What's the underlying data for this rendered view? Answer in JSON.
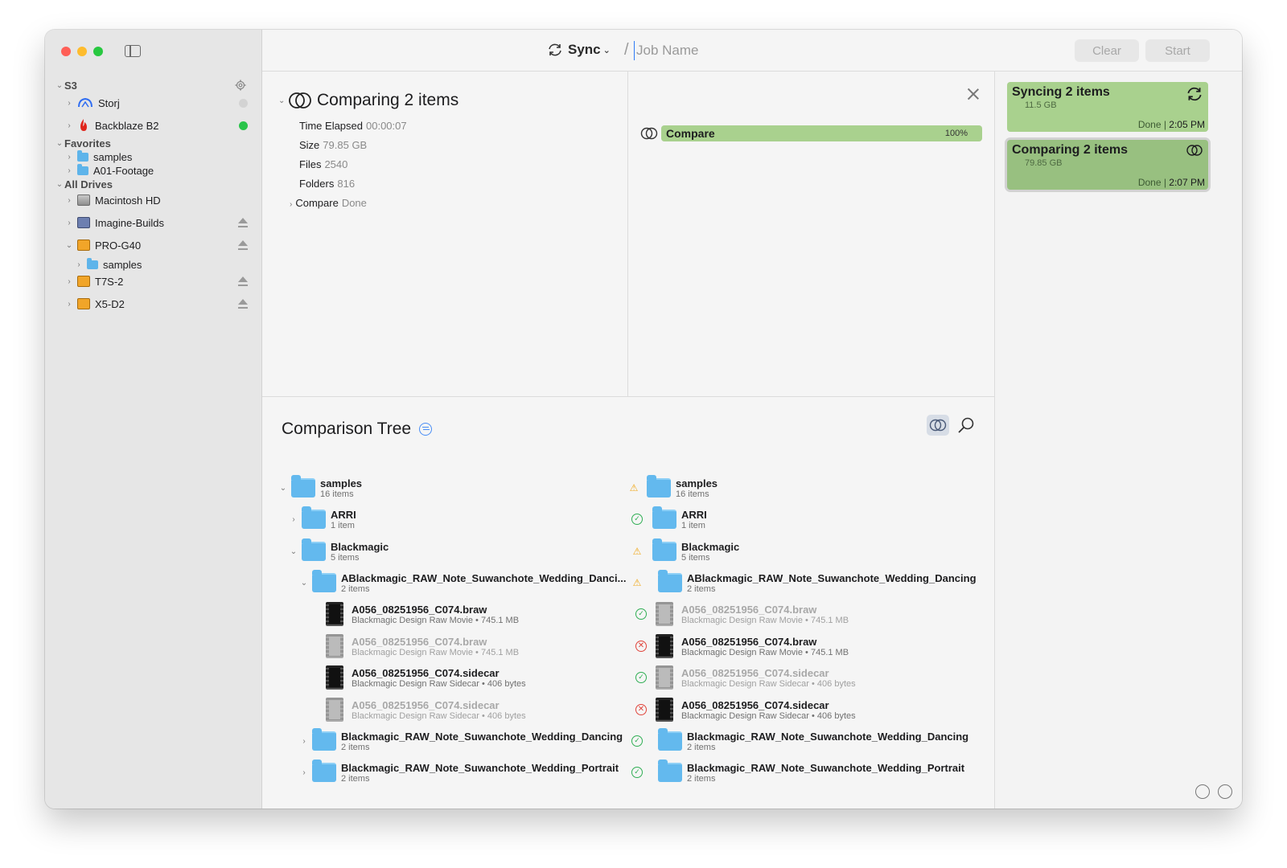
{
  "window": {
    "traffic_lights": {
      "close": "#ff5f57",
      "minimize": "#febc2e",
      "zoom": "#28c840"
    }
  },
  "sidebar": {
    "sections": [
      {
        "label": "S3"
      },
      {
        "label": "Favorites"
      },
      {
        "label": "All Drives"
      }
    ],
    "s3_items": [
      {
        "label": "Storj",
        "icon": "storj-cloud-icon",
        "status": "gray"
      },
      {
        "label": "Backblaze B2",
        "icon": "backblaze-flame-icon",
        "status": "green"
      }
    ],
    "favorites": [
      {
        "label": "samples",
        "icon": "folder-icon"
      },
      {
        "label": "A01-Footage",
        "icon": "folder-icon"
      }
    ],
    "drives": [
      {
        "label": "Macintosh HD",
        "icon": "hard-drive-icon"
      },
      {
        "label": "Imagine-Builds",
        "icon": "disk-image-icon"
      },
      {
        "label": "PRO-G40",
        "icon": "external-drive-icon"
      },
      {
        "label": "samples",
        "icon": "folder-icon"
      },
      {
        "label": "T7S-2",
        "icon": "external-drive-icon"
      },
      {
        "label": "X5-D2",
        "icon": "external-drive-icon"
      }
    ]
  },
  "toolbar": {
    "mode_label": "Sync",
    "separator": "/",
    "job_name_placeholder": "Job Name",
    "clear_label": "Clear",
    "start_label": "Start"
  },
  "detail": {
    "title": "Comparing 2 items",
    "stats": [
      {
        "label": "Time Elapsed",
        "value": "00:00:07"
      },
      {
        "label": "Size",
        "value": "79.85 GB"
      },
      {
        "label": "Files",
        "value": "2540"
      },
      {
        "label": "Folders",
        "value": "816"
      },
      {
        "label": "Compare",
        "value": "Done"
      }
    ],
    "progress": {
      "label": "Compare",
      "percent_text": "100%",
      "fraction": 1.0,
      "color": "#a9d18e"
    }
  },
  "jobs": [
    {
      "title": "Syncing 2 items",
      "size": "11.5 GB",
      "status": "Done",
      "time": "2:05 PM",
      "icon": "sync-icon"
    },
    {
      "title": "Comparing 2 items",
      "size": "79.85 GB",
      "status": "Done",
      "time": "2:07 PM",
      "icon": "compare-icon"
    }
  ],
  "tree": {
    "title": "Comparison Tree",
    "left": [
      {
        "name": "samples",
        "sub": "16 items",
        "kind": "folder",
        "exp": "open",
        "depth": 0,
        "dim": false
      },
      {
        "name": "ARRI",
        "sub": "1 item",
        "kind": "folder",
        "exp": "closed",
        "depth": 1,
        "dim": false
      },
      {
        "name": "Blackmagic",
        "sub": "5 items",
        "kind": "folder",
        "exp": "open",
        "depth": 1,
        "dim": false
      },
      {
        "name": "ABlackmagic_RAW_Note_Suwanchote_Wedding_Danci...",
        "sub": "2 items",
        "kind": "folder",
        "exp": "open",
        "depth": 2,
        "dim": false
      },
      {
        "name": "A056_08251956_C074.braw",
        "sub": "Blackmagic Design Raw Movie • 745.1 MB",
        "kind": "file",
        "exp": "",
        "depth": 3,
        "dim": false
      },
      {
        "name": "A056_08251956_C074.braw",
        "sub": "Blackmagic Design Raw Movie • 745.1 MB",
        "kind": "file",
        "exp": "",
        "depth": 3,
        "dim": true
      },
      {
        "name": "A056_08251956_C074.sidecar",
        "sub": "Blackmagic Design Raw Sidecar • 406 bytes",
        "kind": "file",
        "exp": "",
        "depth": 3,
        "dim": false
      },
      {
        "name": "A056_08251956_C074.sidecar",
        "sub": "Blackmagic Design Raw Sidecar • 406 bytes",
        "kind": "file",
        "exp": "",
        "depth": 3,
        "dim": true
      },
      {
        "name": "Blackmagic_RAW_Note_Suwanchote_Wedding_Dancing",
        "sub": "2 items",
        "kind": "folder",
        "exp": "closed",
        "depth": 2,
        "dim": false
      },
      {
        "name": "Blackmagic_RAW_Note_Suwanchote_Wedding_Portrait",
        "sub": "2 items",
        "kind": "folder",
        "exp": "closed",
        "depth": 2,
        "dim": false
      }
    ],
    "right": [
      {
        "name": "samples",
        "sub": "16 items",
        "kind": "folder",
        "status": "warn",
        "depth": 0,
        "dim": false
      },
      {
        "name": "ARRI",
        "sub": "1 item",
        "kind": "folder",
        "status": "ok",
        "depth": 1,
        "dim": false
      },
      {
        "name": "Blackmagic",
        "sub": "5 items",
        "kind": "folder",
        "status": "warn",
        "depth": 1,
        "dim": false
      },
      {
        "name": "ABlackmagic_RAW_Note_Suwanchote_Wedding_Dancing",
        "sub": "2 items",
        "kind": "folder",
        "status": "warn",
        "depth": 2,
        "dim": false
      },
      {
        "name": "A056_08251956_C074.braw",
        "sub": "Blackmagic Design Raw Movie • 745.1 MB",
        "kind": "file",
        "status": "okwarn",
        "depth": 3,
        "dim": true
      },
      {
        "name": "A056_08251956_C074.braw",
        "sub": "Blackmagic Design Raw Movie • 745.1 MB",
        "kind": "file",
        "status": "err",
        "depth": 3,
        "dim": false
      },
      {
        "name": "A056_08251956_C074.sidecar",
        "sub": "Blackmagic Design Raw Sidecar • 406 bytes",
        "kind": "file",
        "status": "okwarn",
        "depth": 3,
        "dim": true
      },
      {
        "name": "A056_08251956_C074.sidecar",
        "sub": "Blackmagic Design Raw Sidecar • 406 bytes",
        "kind": "file",
        "status": "err",
        "depth": 3,
        "dim": false
      },
      {
        "name": "Blackmagic_RAW_Note_Suwanchote_Wedding_Dancing",
        "sub": "2 items",
        "kind": "folder",
        "status": "ok",
        "depth": 2,
        "dim": false
      },
      {
        "name": "Blackmagic_RAW_Note_Suwanchote_Wedding_Portrait",
        "sub": "2 items",
        "kind": "folder",
        "status": "ok",
        "depth": 2,
        "dim": false
      }
    ]
  }
}
